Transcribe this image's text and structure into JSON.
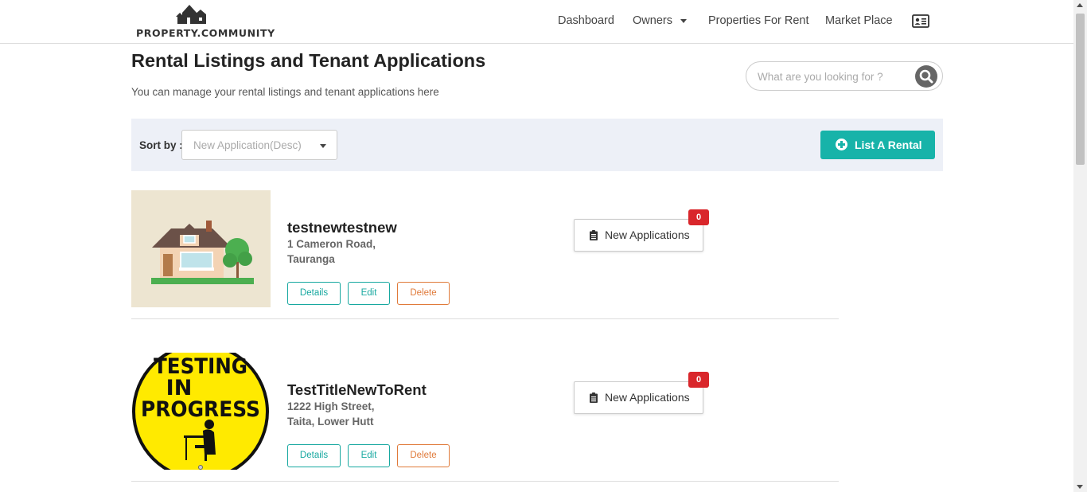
{
  "header": {
    "logo_text": "PROPERTY.COMMUNITY",
    "nav": [
      {
        "label": "Dashboard"
      },
      {
        "label": "Owners"
      },
      {
        "label": "Properties For Rent"
      },
      {
        "label": "Market Place"
      }
    ]
  },
  "page": {
    "title": "Rental Listings and Tenant Applications",
    "subtitle": "You can manage your rental listings and tenant applications here"
  },
  "search": {
    "placeholder": "What are you looking for ?"
  },
  "sort": {
    "label": "Sort by :",
    "selected": "New Application(Desc)"
  },
  "list_button": {
    "label": "List A Rental"
  },
  "listings": [
    {
      "title": "testnewtestnew",
      "address_line1": "1 Cameron Road,",
      "address_line2": "Tauranga",
      "details_label": "Details",
      "edit_label": "Edit",
      "delete_label": "Delete",
      "applications_label": "New Applications",
      "applications_count": "0"
    },
    {
      "title": "TestTitleNewToRent",
      "address_line1": "1222 High Street,",
      "address_line2": "Taita, Lower Hutt",
      "details_label": "Details",
      "edit_label": "Edit",
      "delete_label": "Delete",
      "applications_label": "New Applications",
      "applications_count": "0",
      "image_text": [
        "TESTING",
        "IN",
        "PROGRESS"
      ]
    }
  ],
  "colors": {
    "accent": "#17b3a9",
    "delete": "#e07a3a",
    "badge": "#d9262b",
    "sortbar_bg": "#edf0f7"
  }
}
